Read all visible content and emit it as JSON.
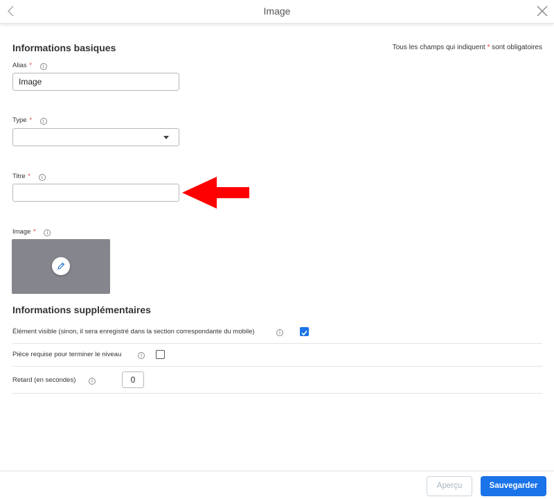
{
  "header": {
    "title": "Image"
  },
  "required_note": {
    "prefix": "Tous les champs qui indiquent ",
    "star": "*",
    "suffix": " sont obligatoires"
  },
  "basic_section": {
    "title": "Informations basiques"
  },
  "fields": {
    "alias": {
      "label": "Alias",
      "star": "*",
      "value": "Image"
    },
    "type": {
      "label": "Type",
      "star": "*",
      "value": ""
    },
    "titre": {
      "label": "Titre",
      "star": "*",
      "value": ""
    },
    "image": {
      "label": "Image",
      "star": "*"
    }
  },
  "extra_section": {
    "title": "Informations supplémentaires",
    "visible": {
      "label": "Élément visible (sinon, il sera enregistré dans la section correspondante du mobile)",
      "checked": true
    },
    "required_piece": {
      "label": "Pièce requise pour terminer le niveau",
      "checked": false
    },
    "delay": {
      "label": "Retard (en secondes)",
      "value": "0"
    }
  },
  "info_glyph": "i",
  "footer": {
    "preview_label": "Aperçu",
    "save_label": "Sauvegarder"
  },
  "colors": {
    "accent": "#1a73e8",
    "required": "#e53935",
    "annotation_arrow": "#ff0000",
    "image_placeholder": "#85868d"
  }
}
